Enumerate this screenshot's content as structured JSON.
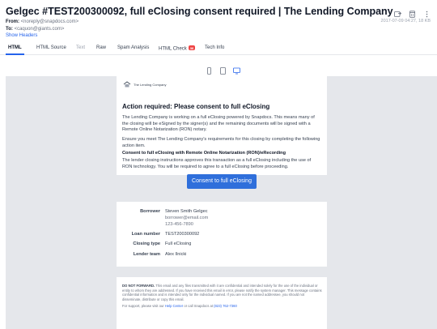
{
  "email": {
    "subject": "Gelgec #TEST200300092, full eClosing consent required | The Lending Company",
    "from_label": "From:",
    "from_value": "<noreply@snapdocs.com>",
    "to_label": "To:",
    "to_value": "<caquon@giants.com>",
    "date_size": "2017-07-09 04:27, 18 KB",
    "show_headers": "Show Headers"
  },
  "tabs": [
    {
      "label": "HTML"
    },
    {
      "label": "HTML Source"
    },
    {
      "label": "Text"
    },
    {
      "label": "Raw"
    },
    {
      "label": "Spam Analysis"
    },
    {
      "label": "HTML Check",
      "badge": "36"
    },
    {
      "label": "Tech Info"
    }
  ],
  "message": {
    "logo_text": "The Lending Company",
    "title": "Action required: Please consent to full eClosing",
    "p1": "The Lending Company is working on a full eClosing powered by Snapdocs. This means many of the closing will be eSigned by the signer(s) and the remaining documents will be signed with a Remote Online Notarization (RON) notary.",
    "p2": "Ensure you meet The Lending Company's requirements for this closing by completing the following action item.",
    "p3": "Consent to full eClosing with Remote Online Notarization (RON)/eRecording",
    "p4": "The lender closing instructions approves this transaction as a full eClosing including the use of RON technology. You will be required to agree to a full eClosing before proceeding.",
    "cta": "Consent to full eClosing"
  },
  "details": {
    "borrower_label": "Borrower",
    "borrower_name": "Steven Smith Gelgec",
    "borrower_email": "borrower@email.com",
    "borrower_phone": "123-456-7890",
    "loan_label": "Loan number",
    "loan_value": "TEST200300092",
    "closing_label": "Closing type",
    "closing_value": "Full eClosing",
    "lender_label": "Lender team",
    "lender_value": "Alex Ilnicki"
  },
  "footer": {
    "strong": "DO NOT FORWARD.",
    "text": " This email and any files transmitted with it are confidential and intended solely for the use of the individual or entity to whom they are addressed. If you have received this email in error, please notify the system manager. This message contains confidential information and is intended only for the individual named. If you are not the named addressee, you should not disseminate, distribute or copy this email.",
    "support_pre": "For support, please visit our ",
    "help_center": "Help Center",
    "support_mid": " or call Snapdocs at ",
    "phone": "(823) 762-7360"
  },
  "colors": {
    "accent": "#2563eb",
    "cta": "#2f6fdb",
    "badge": "#ef4444"
  }
}
